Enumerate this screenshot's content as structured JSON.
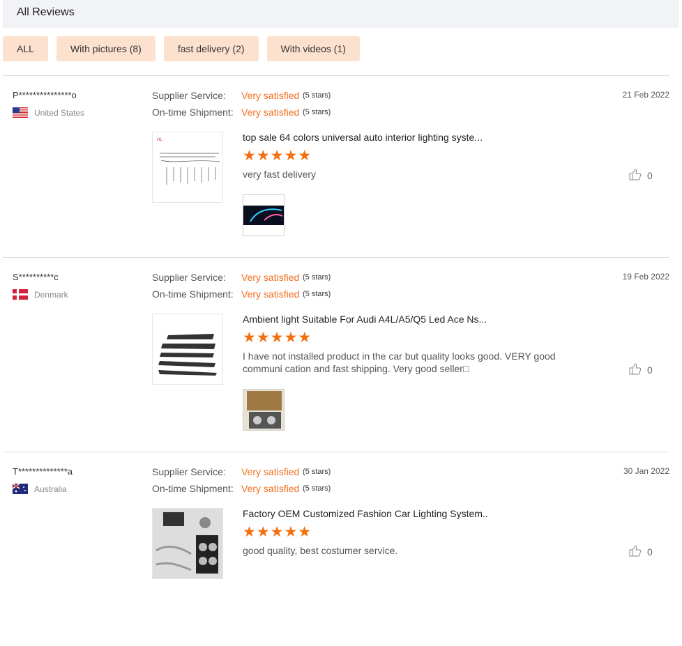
{
  "header": {
    "title": "All Reviews"
  },
  "filters": [
    "ALL",
    "With pictures (8)",
    "fast delivery (2)",
    "With videos (1)"
  ],
  "labels": {
    "supplier": "Supplier Service:",
    "shipment": "On-time Shipment:"
  },
  "reviews": [
    {
      "name": "P***************o",
      "country": "United States",
      "flag": "us",
      "supplier": "Very satisfied",
      "supplier_stars": "(5 stars)",
      "shipment": "Very satisfied",
      "shipment_stars": "(5 stars)",
      "date": "21 Feb 2022",
      "product": "top sale 64 colors universal auto interior lighting syste...",
      "stars": "★★★★★",
      "text": "very fast delivery",
      "likes": "0"
    },
    {
      "name": "S**********c",
      "country": "Denmark",
      "flag": "dk",
      "supplier": "Very satisfied",
      "supplier_stars": "(5 stars)",
      "shipment": "Very satisfied",
      "shipment_stars": "(5 stars)",
      "date": "19 Feb 2022",
      "product": "Ambient light Suitable For Audi A4L/A5/Q5 Led Ace Ns...",
      "stars": "★★★★★",
      "text": "I have not installed product in the car but quality looks good. VERY good communi cation and fast shipping. Very good seller□",
      "likes": "0"
    },
    {
      "name": "T**************a",
      "country": "Australia",
      "flag": "au",
      "supplier": "Very satisfied",
      "supplier_stars": "(5 stars)",
      "shipment": "Very satisfied",
      "shipment_stars": "(5 stars)",
      "date": "30 Jan 2022",
      "product": "Factory OEM Customized Fashion Car Lighting System..",
      "stars": "★★★★★",
      "text": "good quality, best costumer service.",
      "likes": "0"
    }
  ]
}
